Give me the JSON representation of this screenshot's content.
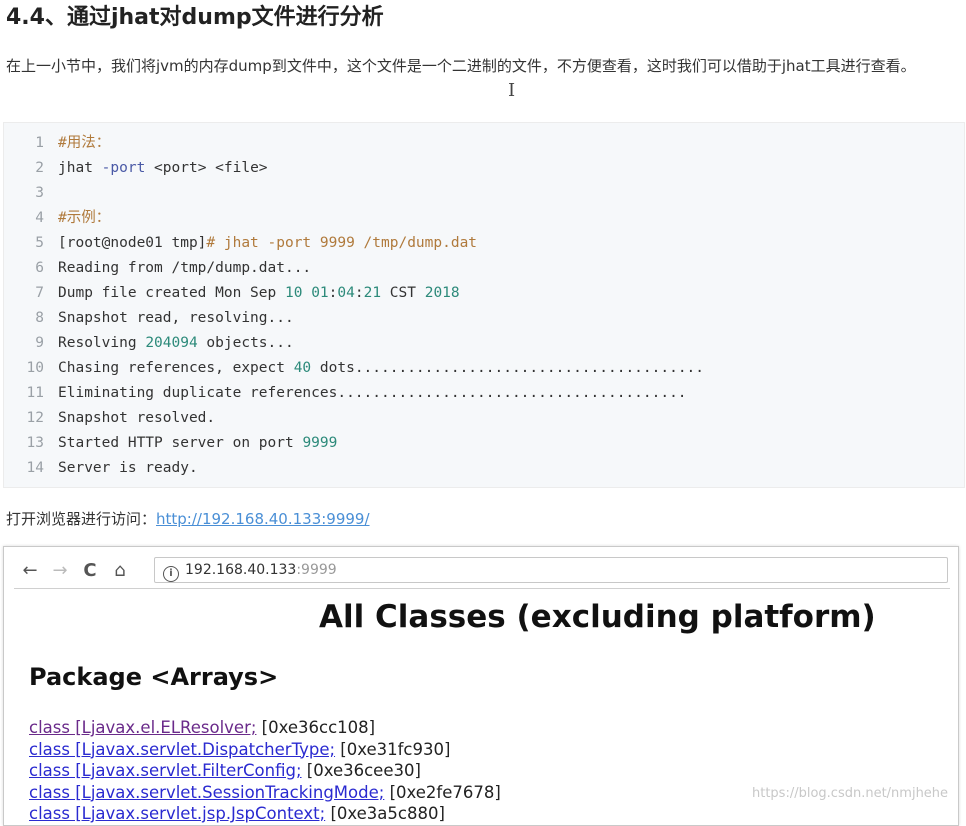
{
  "heading": "4.4、通过jhat对dump文件进行分析",
  "paragraph": "在上一小节中，我们将jvm的内存dump到文件中，这个文件是一个二进制的文件，不方便查看，这时我们可以借助于jhat工具进行查看。",
  "code_lines": [
    {
      "n": "1",
      "parts": [
        {
          "t": "#用法：",
          "c": "comment"
        }
      ]
    },
    {
      "n": "2",
      "parts": [
        {
          "t": "jhat ",
          "c": "plain"
        },
        {
          "t": "-port",
          "c": "param"
        },
        {
          "t": " <port> <file>",
          "c": "plain"
        }
      ]
    },
    {
      "n": "3",
      "parts": []
    },
    {
      "n": "4",
      "parts": [
        {
          "t": "#示例：",
          "c": "comment"
        }
      ]
    },
    {
      "n": "5",
      "parts": [
        {
          "t": "[root@node01 tmp]",
          "c": "plain"
        },
        {
          "t": "# jhat -port 9999 /tmp/dump.dat",
          "c": "prompt"
        }
      ]
    },
    {
      "n": "6",
      "parts": [
        {
          "t": "Reading from /tmp/dump.dat...",
          "c": "plain"
        }
      ]
    },
    {
      "n": "7",
      "parts": [
        {
          "t": "Dump file created Mon Sep ",
          "c": "plain"
        },
        {
          "t": "10",
          "c": "num"
        },
        {
          "t": " ",
          "c": "plain"
        },
        {
          "t": "01",
          "c": "num"
        },
        {
          "t": ":",
          "c": "plain"
        },
        {
          "t": "04",
          "c": "num"
        },
        {
          "t": ":",
          "c": "plain"
        },
        {
          "t": "21",
          "c": "num"
        },
        {
          "t": " CST ",
          "c": "plain"
        },
        {
          "t": "2018",
          "c": "num"
        }
      ]
    },
    {
      "n": "8",
      "parts": [
        {
          "t": "Snapshot read, resolving...",
          "c": "plain"
        }
      ]
    },
    {
      "n": "9",
      "parts": [
        {
          "t": "Resolving ",
          "c": "plain"
        },
        {
          "t": "204094",
          "c": "num"
        },
        {
          "t": " objects...",
          "c": "plain"
        }
      ]
    },
    {
      "n": "10",
      "parts": [
        {
          "t": "Chasing references, expect ",
          "c": "plain"
        },
        {
          "t": "40",
          "c": "num"
        },
        {
          "t": " dots........................................",
          "c": "plain"
        }
      ]
    },
    {
      "n": "11",
      "parts": [
        {
          "t": "Eliminating duplicate references........................................",
          "c": "plain"
        }
      ]
    },
    {
      "n": "12",
      "parts": [
        {
          "t": "Snapshot resolved.",
          "c": "plain"
        }
      ]
    },
    {
      "n": "13",
      "parts": [
        {
          "t": "Started HTTP server on port ",
          "c": "plain"
        },
        {
          "t": "9999",
          "c": "num"
        }
      ]
    },
    {
      "n": "14",
      "parts": [
        {
          "t": "Server is ready.",
          "c": "plain"
        }
      ]
    }
  ],
  "link_prefix": "打开浏览器进行访问：",
  "link_text": "http://192.168.40.133:9999/",
  "browser": {
    "back_icon": "←",
    "forward_icon": "→",
    "reload_icon": "C",
    "home_icon": "⌂",
    "info_icon": "i",
    "url_host": "192.168.40.133",
    "url_port": ":9999",
    "page_title": "All Classes (excluding platform)",
    "package_title": "Package <Arrays>",
    "classes": [
      {
        "name": "class [Ljavax.el.ELResolver;",
        "addr": " [0xe36cc108]",
        "visited": true
      },
      {
        "name": "class [Ljavax.servlet.DispatcherType;",
        "addr": " [0xe31fc930]",
        "visited": false
      },
      {
        "name": "class [Ljavax.servlet.FilterConfig;",
        "addr": " [0xe36cee30]",
        "visited": false
      },
      {
        "name": "class [Ljavax.servlet.SessionTrackingMode;",
        "addr": " [0xe2fe7678]",
        "visited": false
      },
      {
        "name": "class [Ljavax.servlet.jsp.JspContext;",
        "addr": " [0xe3a5c880]",
        "visited": false
      }
    ]
  },
  "watermark": "https://blog.csdn.net/nmjhehe"
}
